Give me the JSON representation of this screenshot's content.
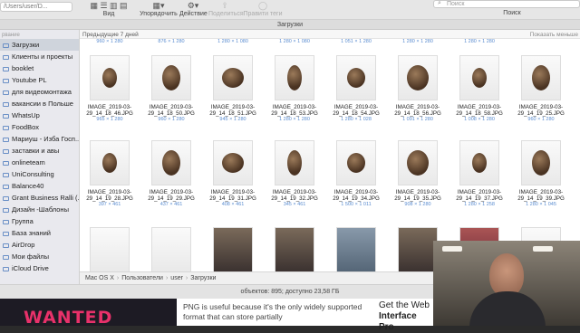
{
  "toolbar": {
    "path_field": "/Users/user/D...",
    "view_label": "Вид",
    "arrange_label": "Упорядочить",
    "action_label": "Действие",
    "share_label": "Поделиться",
    "tags_label": "Правити теги",
    "search_placeholder": "Поиск",
    "search_label": "Поиск"
  },
  "window_title": "Загрузки",
  "sidebar": {
    "heading": "рвание",
    "items": [
      {
        "label": "Загрузки",
        "active": true
      },
      {
        "label": "Клиенты и проекты"
      },
      {
        "label": "booklet"
      },
      {
        "label": "Youtube PL"
      },
      {
        "label": "для видеомонтажа"
      },
      {
        "label": "вакансии в Польше"
      },
      {
        "label": "WhatsUp"
      },
      {
        "label": "FoodBox"
      },
      {
        "label": "Мариуш - Изба Госп..."
      },
      {
        "label": "заставки и авы"
      },
      {
        "label": "onlineteam"
      },
      {
        "label": "UniConsulting"
      },
      {
        "label": "Balance40"
      },
      {
        "label": "Grant Business Ralli (..."
      },
      {
        "label": "Дизайн -Шаблоны"
      },
      {
        "label": "Группа"
      },
      {
        "label": "База знаний"
      },
      {
        "label": "AirDrop"
      },
      {
        "label": "Мои файлы"
      },
      {
        "label": "iCloud Drive"
      }
    ]
  },
  "content": {
    "section_title": "Предыдущие 7 дней",
    "show_less": "Показать меньше",
    "top_dims": [
      "960 × 1 280",
      "876 × 1 280",
      "1 280 × 1 080",
      "1 280 × 1 080",
      "1 051 × 1 280",
      "1 280 × 1 280",
      "1 280 × 1 280"
    ],
    "row1": [
      {
        "name": "IMAGE_2019-03-29_14_18_46.JPG",
        "dim": "965 × 1 280"
      },
      {
        "name": "IMAGE_2019-03-29_14_18_50.JPG",
        "dim": "960 × 1 280"
      },
      {
        "name": "IMAGE_2019-03-29_14_18_51.JPG",
        "dim": "945 × 1 280"
      },
      {
        "name": "IMAGE_2019-03-29_14_18_53.JPG",
        "dim": "1 280 × 1 280"
      },
      {
        "name": "IMAGE_2019-03-29_14_18_54.JPG",
        "dim": "1 280 × 1 028"
      },
      {
        "name": "IMAGE_2019-03-29_14_18_56.JPG",
        "dim": "1 091 × 1 280"
      },
      {
        "name": "IMAGE_2019-03-29_14_18_58.JPG",
        "dim": "1 008 × 1 280"
      },
      {
        "name": "IMAGE_2019-03-29_14_19_25.JPG",
        "dim": "960 × 1 280"
      }
    ],
    "row2": [
      {
        "name": "IMAGE_2019-03-29_14_19_28.JPG",
        "dim": "397 × 461"
      },
      {
        "name": "IMAGE_2019-03-29_14_19_29.JPG",
        "dim": "437 × 461"
      },
      {
        "name": "IMAGE_2019-03-29_14_19_31.JPG",
        "dim": "408 × 461"
      },
      {
        "name": "IMAGE_2019-03-29_14_19_32.JPG",
        "dim": "345 × 461"
      },
      {
        "name": "IMAGE_2019-03-29_14_19_34.JPG",
        "dim": "1 500 × 1 011"
      },
      {
        "name": "IMAGE_2019-03-29_14_19_35.JPG",
        "dim": "908 × 1 280"
      },
      {
        "name": "IMAGE_2019-03-29_14_19_37.JPG",
        "dim": "1 280 × 1 258"
      },
      {
        "name": "IMAGE_2019-03-29_14_19_39.JPG",
        "dim": "1 280 × 1 045"
      }
    ]
  },
  "pathbar": [
    "Mac OS X",
    "Пользователи",
    "user",
    "Загрузки"
  ],
  "status": "объектов: 895; доступно 23,58 ГБ",
  "below": {
    "wanted": "WANTED",
    "para": "PNG is useful because it's the only widely supported format that can store partially",
    "promo_1": "Get the Web",
    "promo_2": "Interface Pro"
  }
}
